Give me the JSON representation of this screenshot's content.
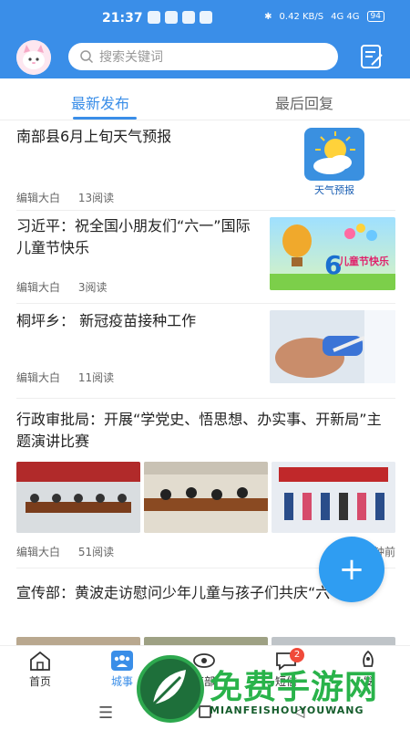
{
  "status_bar": {
    "time": "21:37",
    "speed": "0.42 KB/S",
    "network": "4G 4G",
    "battery": "94"
  },
  "header": {
    "search_placeholder": "搜索关键词"
  },
  "tabs": [
    {
      "label": "最新发布",
      "active": true
    },
    {
      "label": "最后回复",
      "active": false
    }
  ],
  "feed": [
    {
      "title": "南部县6月上旬天气预报",
      "author": "编辑大白",
      "reads": "13阅读",
      "thumb_label": "天气预报"
    },
    {
      "title": "习近平：祝全国小朋友们“六一”国际儿童节快乐",
      "author": "编辑大白",
      "reads": "3阅读",
      "thumb_label": "儿童节快乐"
    },
    {
      "title": "桐坪乡： 新冠疫苗接种工作",
      "author": "编辑大白",
      "reads": "11阅读"
    },
    {
      "title": "行政审批局：开展“学党史、悟思想、办实事、开新局”主题演讲比赛",
      "author": "编辑大白",
      "reads": "51阅读",
      "time": "钟前"
    },
    {
      "title": "宣传部：黄波走访慰问少年儿童与孩子们共庆“六一”"
    }
  ],
  "fab_label": "+",
  "bottom_nav": [
    {
      "label": "首页",
      "active": false
    },
    {
      "label": "城事",
      "active": true
    },
    {
      "label": "南部",
      "active": false
    },
    {
      "label": "短信",
      "active": false,
      "badge": "2"
    },
    {
      "label": "发",
      "active": false
    }
  ],
  "watermark": {
    "text": "免费手游网",
    "sub": "MIANFEISHOUYOUWANG"
  },
  "colors": {
    "primary": "#3a8ee8",
    "fab": "#2f9df2",
    "badge": "#f04a3a",
    "watermark_green": "#29b34a"
  }
}
